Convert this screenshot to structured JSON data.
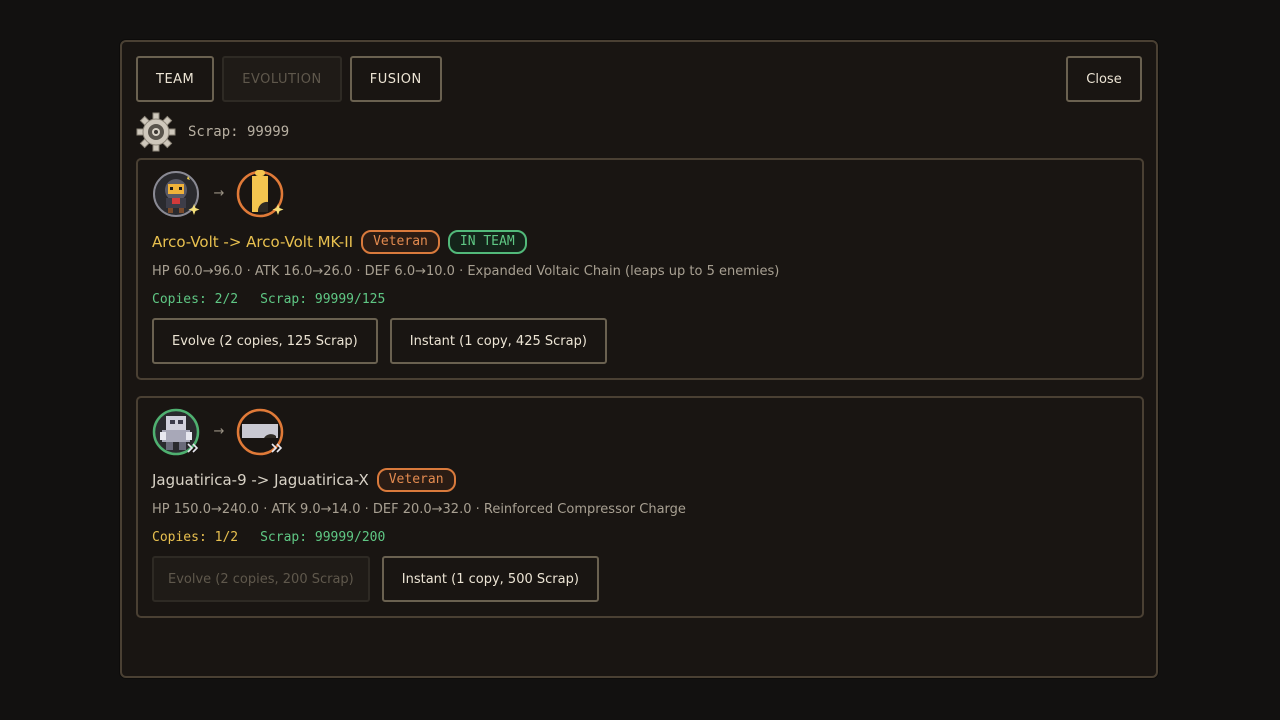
{
  "tabs": [
    {
      "label": "TEAM",
      "disabled": false
    },
    {
      "label": "EVOLUTION",
      "disabled": true
    },
    {
      "label": "FUSION",
      "disabled": false
    }
  ],
  "close_label": "Close",
  "scrap": {
    "label": "Scrap: 99999",
    "icon": "gear-icon"
  },
  "colors": {
    "accent_gold": "#e8c04f",
    "veteran_orange": "#d97a3c",
    "team_green": "#52b97a"
  },
  "cards": [
    {
      "name": "Arco-Volt -> Arco-Volt MK-II",
      "from_icon": "robot-portrait-icon",
      "to_icon": "silhouette-icon",
      "arrow": "→",
      "badges": [
        "Veteran",
        "IN TEAM"
      ],
      "stats": "HP 60.0→96.0 · ATK 16.0→26.0 · DEF 6.0→10.0 · Expanded Voltaic Chain (leaps up to 5 enemies)",
      "copies": "Copies: 2/2",
      "scrap": "Scrap: 99999/125",
      "evolve_label": "Evolve (2 copies, 125 Scrap)",
      "instant_label": "Instant (1 copy, 425 Scrap)"
    },
    {
      "name": "Jaguatirica-9 -> Jaguatirica-X",
      "from_icon": "mech-portrait-icon",
      "to_icon": "silhouette-icon",
      "arrow": "→",
      "badges": [
        "Veteran"
      ],
      "stats": "HP 150.0→240.0 · ATK 9.0→14.0 · DEF 20.0→32.0 · Reinforced Compressor Charge",
      "copies": "Copies: 1/2",
      "scrap": "Scrap: 99999/200",
      "evolve_label": "Evolve (2 copies, 200 Scrap)",
      "instant_label": "Instant (1 copy, 500 Scrap)"
    }
  ]
}
